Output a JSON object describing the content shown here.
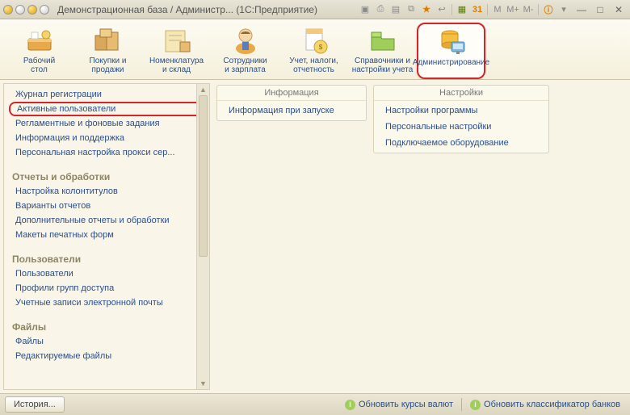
{
  "title": "Демонстрационная база / Администр...  (1С:Предприятие)",
  "mem_buttons": [
    "M",
    "M+",
    "M-"
  ],
  "toolbar": [
    {
      "label": "Рабочий\nстол",
      "name": "tool-desktop"
    },
    {
      "label": "Покупки и\nпродажи",
      "name": "tool-sales"
    },
    {
      "label": "Номенклатура\nи склад",
      "name": "tool-stock"
    },
    {
      "label": "Сотрудники\nи зарплата",
      "name": "tool-staff"
    },
    {
      "label": "Учет, налоги,\nотчетность",
      "name": "tool-tax"
    },
    {
      "label": "Справочники и\nнастройки учета",
      "name": "tool-dirs"
    },
    {
      "label": "Администрирование",
      "name": "tool-admin",
      "highlighted": true
    }
  ],
  "sidebar": {
    "top": [
      {
        "label": "Журнал регистрации",
        "name": "sb-journal"
      },
      {
        "label": "Активные пользователи",
        "name": "sb-active-users",
        "highlighted": true
      },
      {
        "label": "Регламентные и фоновые задания",
        "name": "sb-scheduled"
      },
      {
        "label": "Информация и поддержка",
        "name": "sb-support"
      },
      {
        "label": "Персональная настройка прокси сер...",
        "name": "sb-proxy"
      }
    ],
    "groups": [
      {
        "title": "Отчеты и обработки",
        "items": [
          {
            "label": "Настройка колонтитулов",
            "name": "sb-headers"
          },
          {
            "label": "Варианты отчетов",
            "name": "sb-reports"
          },
          {
            "label": "Дополнительные отчеты и обработки",
            "name": "sb-extra-reports"
          },
          {
            "label": "Макеты печатных форм",
            "name": "sb-print-forms"
          }
        ]
      },
      {
        "title": "Пользователи",
        "items": [
          {
            "label": "Пользователи",
            "name": "sb-users"
          },
          {
            "label": "Профили групп доступа",
            "name": "sb-access-profiles"
          },
          {
            "label": "Учетные записи электронной почты",
            "name": "sb-email"
          }
        ]
      },
      {
        "title": "Файлы",
        "items": [
          {
            "label": "Файлы",
            "name": "sb-files"
          },
          {
            "label": "Редактируемые файлы",
            "name": "sb-edited-files"
          }
        ]
      }
    ]
  },
  "panels": {
    "info": {
      "title": "Информация",
      "items": [
        {
          "label": "Информация при запуске",
          "name": "pi-startup-info"
        }
      ]
    },
    "settings": {
      "title": "Настройки",
      "items": [
        {
          "label": "Настройки программы",
          "name": "ps-program"
        },
        {
          "label": "Персональные настройки",
          "name": "ps-personal"
        },
        {
          "label": "Подключаемое оборудование",
          "name": "ps-hardware"
        }
      ]
    }
  },
  "statusbar": {
    "history": "История...",
    "link1": "Обновить курсы валют",
    "link2": "Обновить классификатор банков"
  }
}
